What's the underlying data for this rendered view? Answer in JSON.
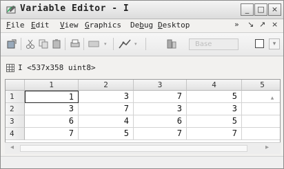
{
  "window": {
    "title": "Variable Editor - I"
  },
  "menubar": {
    "items": [
      {
        "label": "File",
        "ul": "F",
        "rest": "ile"
      },
      {
        "label": "Edit",
        "ul": "E",
        "rest": "dit"
      },
      {
        "label": "View",
        "ul": "V",
        "rest": "iew"
      },
      {
        "label": "Graphics",
        "ul": "G",
        "rest": "raphics"
      },
      {
        "label": "Debug",
        "pre": "De",
        "ul": "b",
        "rest": "ug"
      },
      {
        "label": "Desktop",
        "ul": "D",
        "rest": "esktop"
      }
    ],
    "overflow": "»",
    "pin": "↘",
    "undock": "↗",
    "close": "×"
  },
  "toolbar": {
    "stack_placeholder": "Base"
  },
  "variable": {
    "info": "I <537x358 uint8>"
  },
  "sheet": {
    "columns": [
      "1",
      "2",
      "3",
      "4",
      "5"
    ],
    "rows": [
      {
        "label": "1",
        "cells": [
          "1",
          "3",
          "7",
          "5",
          ""
        ]
      },
      {
        "label": "2",
        "cells": [
          "3",
          "7",
          "3",
          "3",
          ""
        ]
      },
      {
        "label": "3",
        "cells": [
          "6",
          "4",
          "6",
          "5",
          ""
        ]
      },
      {
        "label": "4",
        "cells": [
          "7",
          "5",
          "7",
          "7",
          ""
        ]
      }
    ],
    "selected": {
      "row": 0,
      "col": 0
    }
  }
}
